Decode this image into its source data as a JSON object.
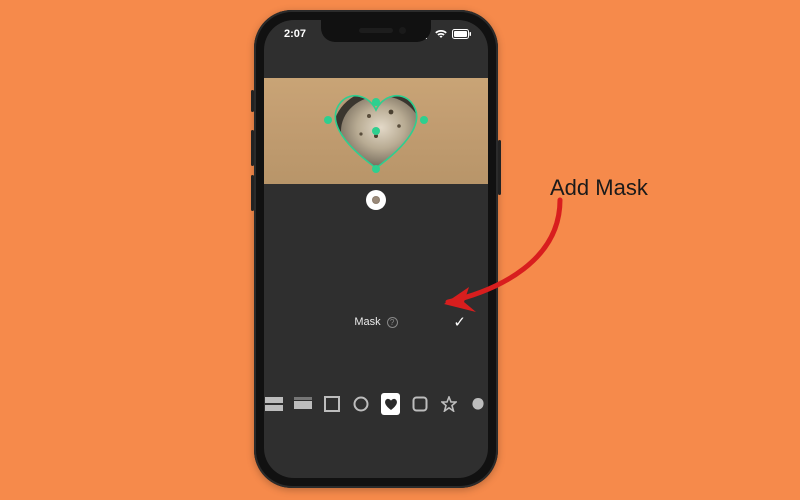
{
  "status": {
    "time": "2:07",
    "signal_icon": "cellular-signal-icon",
    "wifi_icon": "wifi-icon",
    "battery_icon": "battery-icon"
  },
  "editor": {
    "panel_title": "Mask",
    "help_symbol": "?",
    "confirm_symbol": "✓",
    "selected_shape": "heart",
    "shape_options": [
      {
        "id": "split-horizontal"
      },
      {
        "id": "mirror"
      },
      {
        "id": "rectangle"
      },
      {
        "id": "circle"
      },
      {
        "id": "heart"
      },
      {
        "id": "rounded-square"
      },
      {
        "id": "star"
      },
      {
        "id": "blob"
      }
    ]
  },
  "annotation": {
    "label": "Add Mask",
    "arrow_color": "#d81e1e"
  }
}
